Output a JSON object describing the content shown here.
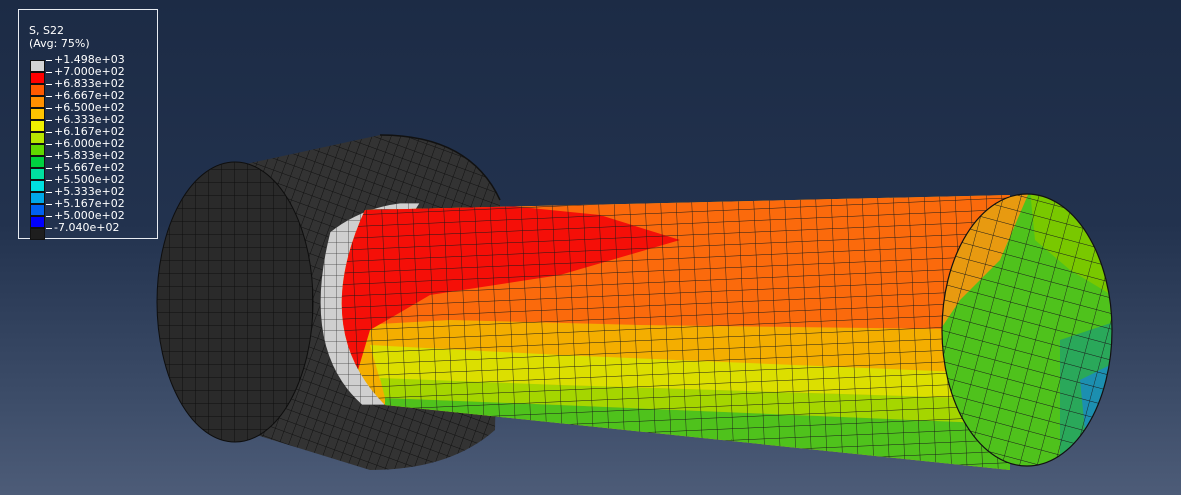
{
  "legend": {
    "title": "S, S22",
    "subtitle": "(Avg: 75%)",
    "values": [
      "+1.498e+03",
      "+7.000e+02",
      "+6.833e+02",
      "+6.667e+02",
      "+6.500e+02",
      "+6.333e+02",
      "+6.167e+02",
      "+6.000e+02",
      "+5.833e+02",
      "+5.667e+02",
      "+5.500e+02",
      "+5.333e+02",
      "+5.167e+02",
      "+5.000e+02",
      "-7.040e+02"
    ],
    "colors": [
      "#d4d4d4",
      "#ff0000",
      "#ff5a00",
      "#ff9000",
      "#ffc400",
      "#f0f000",
      "#b8e600",
      "#60d800",
      "#00d040",
      "#00e0a0",
      "#00e0e0",
      "#00a8e8",
      "#0060f0",
      "#0000ff",
      "#1e1e1e"
    ]
  },
  "contour_colors": {
    "red": "#f50f08",
    "orange": "#fb6a0c",
    "amber": "#f4ae00",
    "yellow": "#dcdf00",
    "lime": "#a5d600",
    "green": "#4fc21c",
    "teal": "#00b58a",
    "grey": "#c8c8c8",
    "dark": "#2c2c2c"
  }
}
